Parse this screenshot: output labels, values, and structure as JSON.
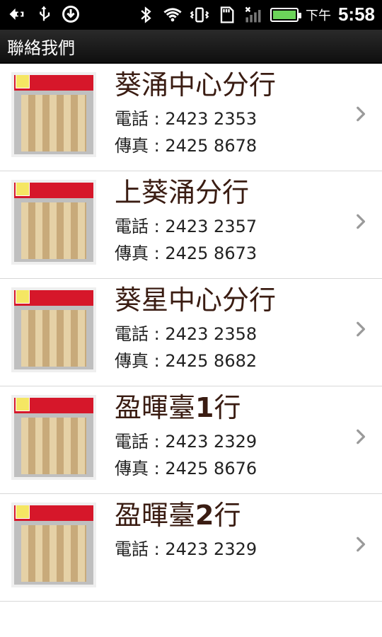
{
  "status_bar": {
    "time": "5:58",
    "ampm": "下午",
    "icons": [
      "back-icon",
      "usb-icon",
      "download-icon",
      "bluetooth-icon",
      "wifi-icon",
      "vibrate-icon",
      "sd-card-icon",
      "signal-icon",
      "battery-icon"
    ]
  },
  "title_bar": {
    "title": "聯絡我們"
  },
  "branches": [
    {
      "name": "葵涌中心分行",
      "tel": "電話 : 2423 2353",
      "fax": "傳真 : 2425 8678"
    },
    {
      "name": "上葵涌分行",
      "tel": "電話 : 2423 2357",
      "fax": "傳真 : 2425 8673"
    },
    {
      "name": "葵星中心分行",
      "tel": "電話 : 2423 2358",
      "fax": "傳真 : 2425 8682"
    },
    {
      "name_prefix": "盈暉臺",
      "name_num": "1",
      "name_suffix": "行",
      "tel": "電話 : 2423 2329",
      "fax": "傳真 : 2425 8676"
    },
    {
      "name_prefix": "盈暉臺",
      "name_num": "2",
      "name_suffix": "行",
      "tel": "電話 : 2423 2329",
      "fax": ""
    }
  ],
  "colors": {
    "title_text": "#3a1c12",
    "status_bar_bg": "#000000",
    "title_bar_bg": "#1a1a1a",
    "battery_fill": "#6cd45a",
    "divider": "#d8d8d8",
    "chevron": "#9a9a9a"
  }
}
